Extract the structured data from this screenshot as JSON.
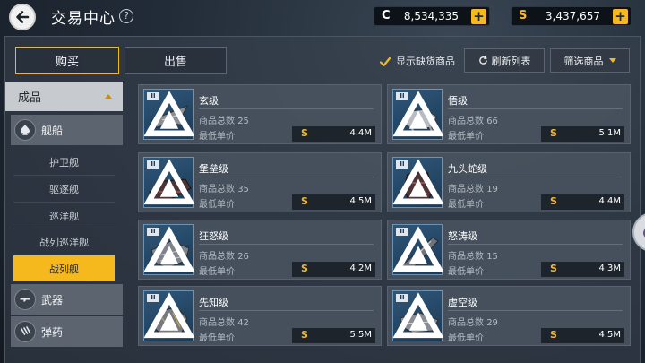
{
  "header": {
    "title": "交易中心",
    "help_label": "?",
    "currency_c": {
      "symbol": "C",
      "value": "8,534,335",
      "add_label": "+"
    },
    "currency_s": {
      "symbol": "S",
      "value": "3,437,657",
      "add_label": "+"
    }
  },
  "tabs": [
    {
      "label": "购买",
      "active": true
    },
    {
      "label": "出售",
      "active": false
    }
  ],
  "toolbar": {
    "show_missing_label": "显示缺货商品",
    "show_missing_checked": true,
    "refresh_label": "刷新列表",
    "filter_label": "筛选商品"
  },
  "sidebar": {
    "category": "成品",
    "main_items": [
      {
        "label": "舰船",
        "icon": "spade-icon"
      },
      {
        "label": "武器",
        "icon": "gun-icon"
      },
      {
        "label": "弹药",
        "icon": "ammo-icon"
      }
    ],
    "sub_items": [
      {
        "label": "护卫舰",
        "active": false
      },
      {
        "label": "驱逐舰",
        "active": false
      },
      {
        "label": "巡洋舰",
        "active": false
      },
      {
        "label": "战列巡洋舰",
        "active": false
      },
      {
        "label": "战列舰",
        "active": true
      }
    ]
  },
  "labels": {
    "count": "商品总数",
    "price": "最低单价",
    "currency_symbol": "S",
    "tier_badge": "II"
  },
  "items": [
    {
      "name": "玄级",
      "count": "25",
      "price": "4.4M"
    },
    {
      "name": "悟级",
      "count": "66",
      "price": "5.1M"
    },
    {
      "name": "堡垒级",
      "count": "35",
      "price": "4.5M"
    },
    {
      "name": "九头蛇级",
      "count": "19",
      "price": "4.4M"
    },
    {
      "name": "狂怒级",
      "count": "26",
      "price": "4.2M"
    },
    {
      "name": "怒涛级",
      "count": "15",
      "price": "4.3M"
    },
    {
      "name": "先知级",
      "count": "42",
      "price": "5.5M"
    },
    {
      "name": "虚空级",
      "count": "29",
      "price": "4.5M"
    }
  ],
  "colors": {
    "accent": "#f5b91e",
    "panel": "#48525e",
    "thumb_bg": "#2f5678"
  }
}
